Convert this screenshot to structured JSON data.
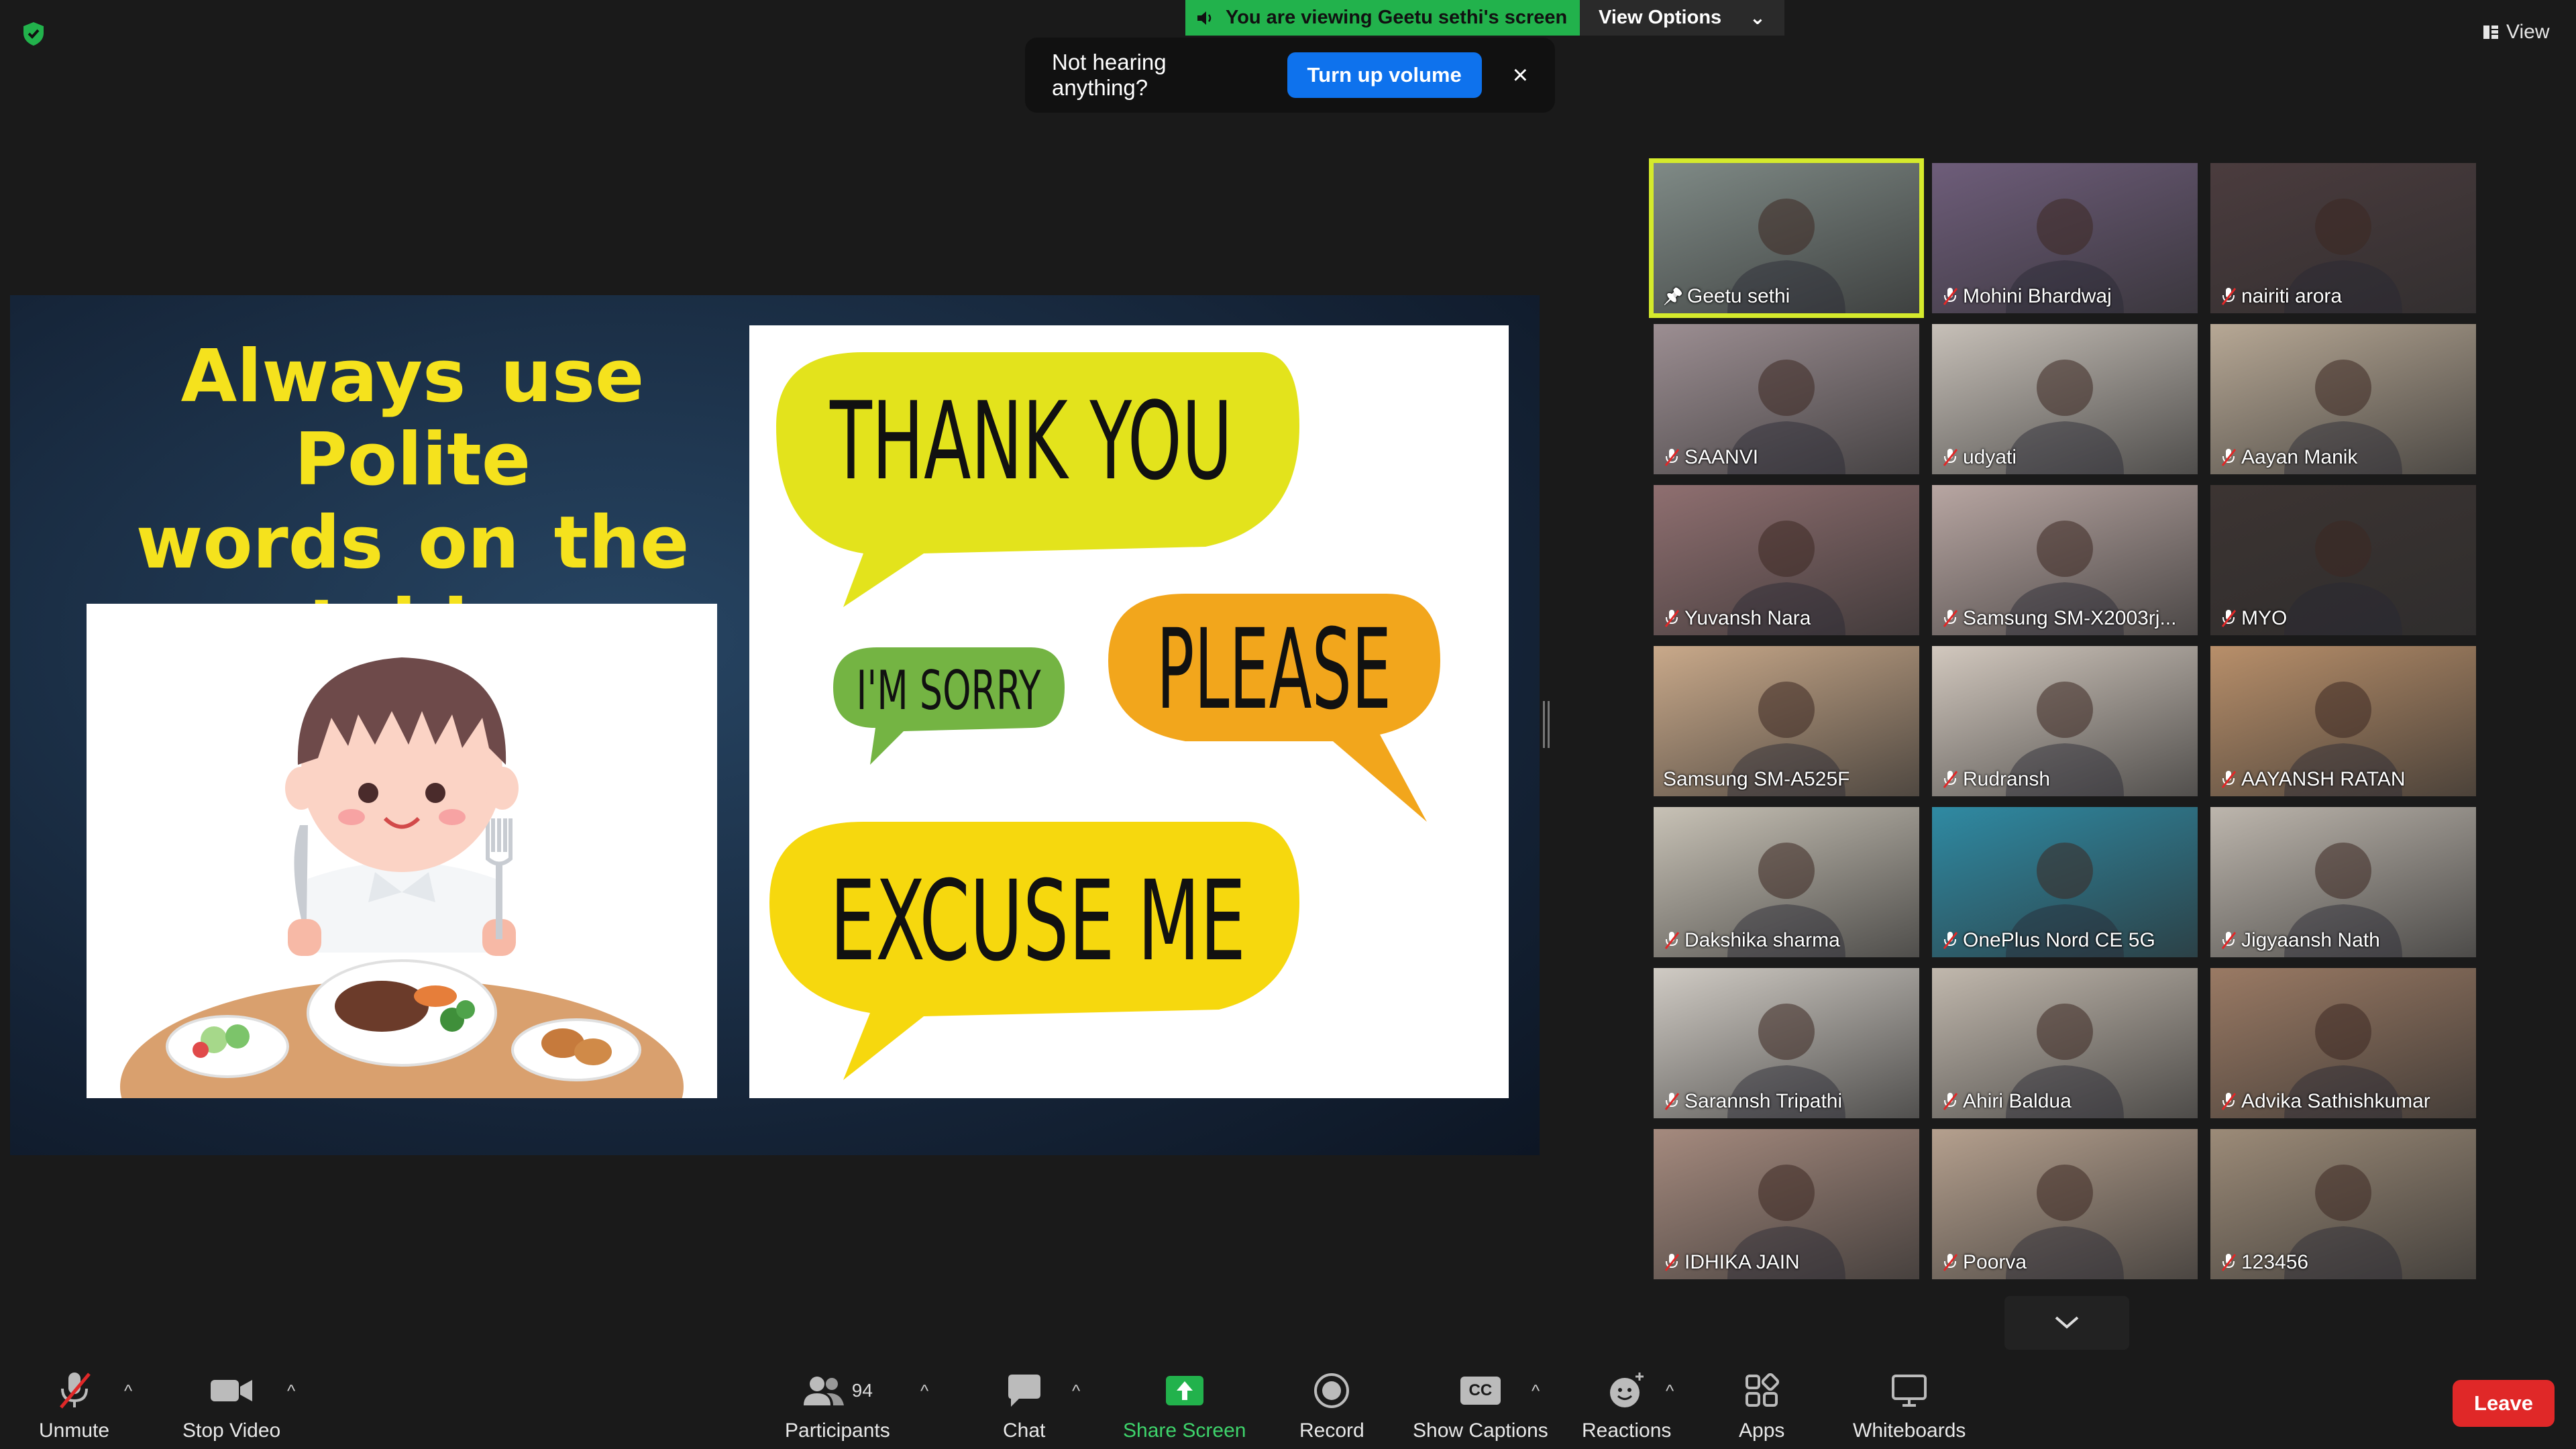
{
  "top": {
    "share_banner": "You are viewing Geetu sethi's screen",
    "view_options": "View Options",
    "view_label": "View"
  },
  "notice": {
    "message": "Not hearing anything?",
    "button": "Turn up volume",
    "close": "×"
  },
  "slide": {
    "title_lines": [
      "Always use Polite",
      "words on the",
      "table"
    ],
    "bubbles": [
      "THANK YOU",
      "I'M SORRY",
      "PLEASE",
      "EXCUSE ME"
    ],
    "colors": {
      "title": "#f5e21d",
      "yellow": "#e3e31c",
      "green": "#74b443",
      "orange": "#f2a61c",
      "gold": "#f6d80e"
    }
  },
  "participants": [
    {
      "name": "Geetu sethi",
      "pinned": true,
      "muted": false,
      "active": true,
      "bg": "#7f8a86"
    },
    {
      "name": "Mohini Bhardwaj",
      "muted": true,
      "bg": "#6e5d7a"
    },
    {
      "name": "nairiti arora",
      "muted": true,
      "bg": "#4b3c3e"
    },
    {
      "name": "SAANVI",
      "muted": true,
      "bg": "#9c8e92"
    },
    {
      "name": "udyati",
      "muted": true,
      "bg": "#c7c0b8"
    },
    {
      "name": "Aayan Manik",
      "muted": true,
      "bg": "#b7a895"
    },
    {
      "name": "Yuvansh Nara",
      "muted": true,
      "bg": "#8f6f70"
    },
    {
      "name": "Samsung SM-X2003rj...",
      "muted": true,
      "bg": "#b8a6a2"
    },
    {
      "name": "MYO",
      "muted": true,
      "bg": "#3c3432"
    },
    {
      "name": "Samsung SM-A525F",
      "muted": false,
      "bg": "#c9a98a"
    },
    {
      "name": "Rudransh",
      "muted": true,
      "bg": "#d2c8be"
    },
    {
      "name": "AAYANSH RATAN",
      "muted": true,
      "bg": "#b88f6a"
    },
    {
      "name": "Dakshika sharma",
      "muted": true,
      "bg": "#c8c2b6"
    },
    {
      "name": "OnePlus Nord CE 5G",
      "muted": true,
      "bg": "#2f8aa3"
    },
    {
      "name": "Jigyaansh Nath",
      "muted": true,
      "bg": "#bdb6ad"
    },
    {
      "name": "Sarannsh Tripathi",
      "muted": true,
      "bg": "#d0cbc4"
    },
    {
      "name": "Ahiri Baldua",
      "muted": true,
      "bg": "#c1b8ad"
    },
    {
      "name": "Advika Sathishkumar",
      "muted": true,
      "bg": "#9a7a64"
    },
    {
      "name": "IDHIKA JAIN",
      "muted": true,
      "bg": "#a58a7e"
    },
    {
      "name": "Poorva",
      "muted": true,
      "bg": "#b5a08e"
    },
    {
      "name": "123456",
      "muted": true,
      "bg": "#9c8b78"
    }
  ],
  "toolbar": {
    "unmute": "Unmute",
    "stop_video": "Stop Video",
    "participants": "Participants",
    "participants_count": "94",
    "chat": "Chat",
    "share_screen": "Share Screen",
    "record": "Record",
    "show_captions": "Show Captions",
    "reactions": "Reactions",
    "apps": "Apps",
    "whiteboards": "Whiteboards",
    "leave": "Leave",
    "captions_icon_text": "CC"
  }
}
